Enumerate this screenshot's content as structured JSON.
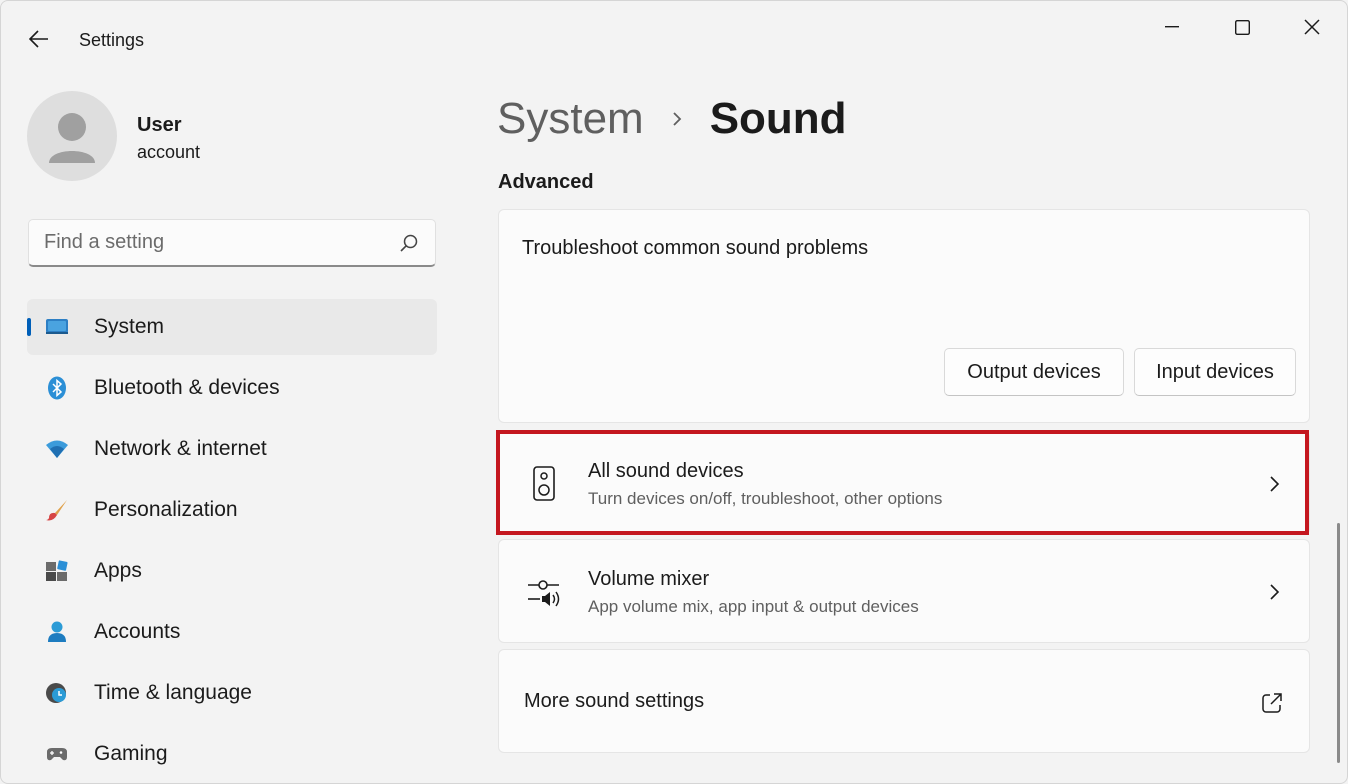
{
  "titlebar": {
    "app_title": "Settings",
    "back_icon": "arrow-left-icon",
    "minimize_icon": "minimize-icon",
    "maximize_icon": "maximize-icon",
    "close_icon": "close-icon"
  },
  "profile": {
    "name": "User",
    "subtitle": "account"
  },
  "search": {
    "placeholder": "Find a setting",
    "value": ""
  },
  "sidebar": {
    "items": [
      {
        "label": "System",
        "icon": "system-display-icon",
        "active": true
      },
      {
        "label": "Bluetooth & devices",
        "icon": "bluetooth-icon"
      },
      {
        "label": "Network & internet",
        "icon": "wifi-icon"
      },
      {
        "label": "Personalization",
        "icon": "brush-icon"
      },
      {
        "label": "Apps",
        "icon": "apps-icon"
      },
      {
        "label": "Accounts",
        "icon": "account-icon"
      },
      {
        "label": "Time & language",
        "icon": "globe-clock-icon"
      },
      {
        "label": "Gaming",
        "icon": "gamepad-icon"
      }
    ]
  },
  "main": {
    "breadcrumb_parent": "System",
    "breadcrumb_current": "Sound",
    "section_title": "Advanced",
    "troubleshoot": {
      "text": "Troubleshoot common sound problems",
      "output_button": "Output devices",
      "input_button": "Input devices"
    },
    "rows": [
      {
        "title": "All sound devices",
        "subtitle": "Turn devices on/off, troubleshoot, other options",
        "icon": "speaker-icon"
      },
      {
        "title": "Volume mixer",
        "subtitle": "App volume mix, app input & output devices",
        "icon": "volume-mixer-icon"
      }
    ],
    "more_settings": {
      "title": "More sound settings",
      "icon": "open-external-icon"
    }
  },
  "colors": {
    "accent": "#005fb8",
    "highlight_border": "#c4171f",
    "background": "#f3f3f3",
    "card": "#fbfbfb"
  }
}
